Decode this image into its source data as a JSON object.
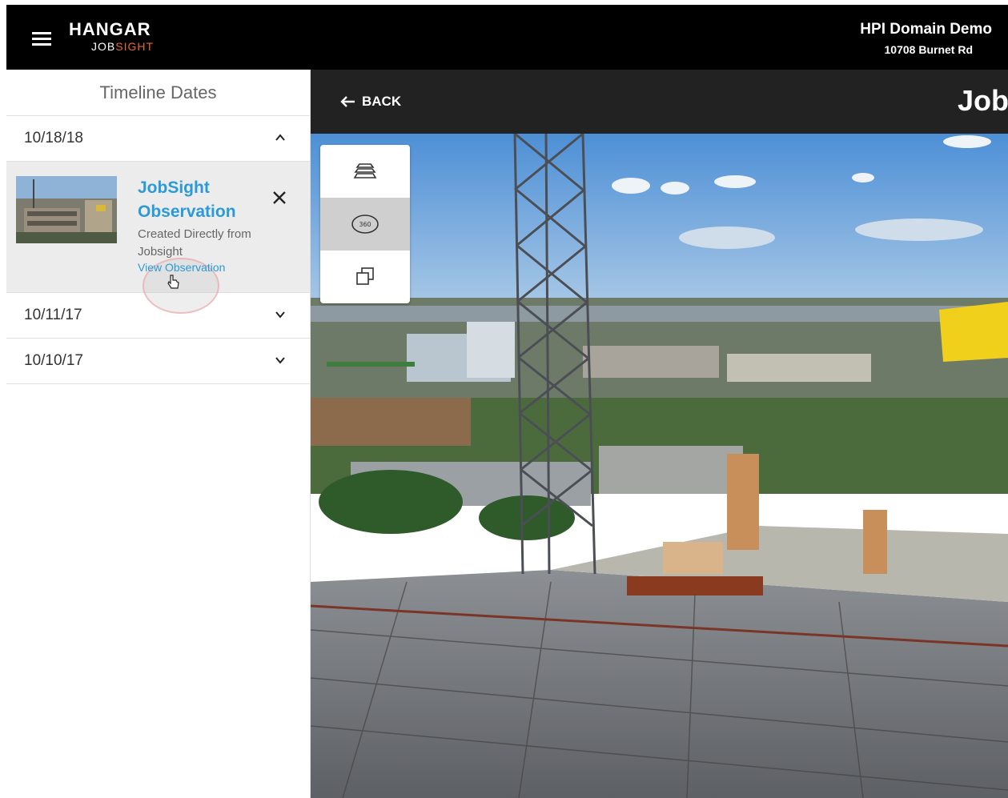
{
  "header": {
    "logo_top": "HANGAR",
    "logo_bottom_a": "JOB",
    "logo_bottom_b": "SIGHT",
    "site_name": "HPI Domain Demo",
    "site_address": "10708 Burnet Rd"
  },
  "sidebar": {
    "title": "Timeline Dates",
    "dates": [
      {
        "label": "10/18/18",
        "expanded": true
      },
      {
        "label": "10/11/17",
        "expanded": false
      },
      {
        "label": "10/10/17",
        "expanded": false
      }
    ],
    "observation": {
      "title": "JobSight Observation",
      "description": "Created Directly from Jobsight",
      "link": "View Observation"
    }
  },
  "viewer": {
    "back_label": "BACK",
    "title": "JobS",
    "tools": [
      {
        "icon": "layers-icon",
        "active": false
      },
      {
        "icon": "view-360-icon",
        "label": "360",
        "active": true
      },
      {
        "icon": "compare-icon",
        "active": false
      }
    ]
  },
  "colors": {
    "accent": "#2b9ad8",
    "brand_orange": "#e8692b",
    "header_bg": "#000000",
    "viewer_header_bg": "#222222"
  }
}
